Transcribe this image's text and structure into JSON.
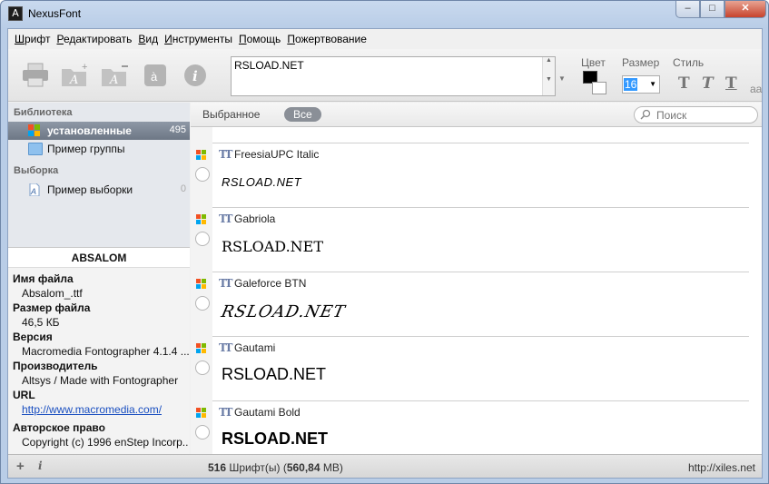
{
  "window": {
    "title": "NexusFont",
    "minimize": "–",
    "maximize": "□",
    "close": "✕"
  },
  "menu": [
    {
      "label": "Шрифт",
      "accel": "Ш",
      "rest": "рифт"
    },
    {
      "label": "Редактировать",
      "accel": "Р",
      "rest": "едактировать"
    },
    {
      "label": "Вид",
      "accel": "В",
      "rest": "ид"
    },
    {
      "label": "Инструменты",
      "accel": "И",
      "rest": "нструменты"
    },
    {
      "label": "Помощь",
      "accel": "П",
      "rest": "омощь"
    },
    {
      "label": "Пожертвование",
      "accel": "П",
      "rest": "ожертвование"
    }
  ],
  "toolbar": {
    "preview_text": "RSLOAD.NET",
    "color_label": "Цвет",
    "size_label": "Размер",
    "size_value": "16",
    "style_label": "Стиль",
    "style_t": "T",
    "aa": "aa",
    "icons": [
      "print-icon",
      "add-font-icon",
      "remove-font-icon",
      "character-map-icon",
      "info-icon"
    ],
    "colors": {
      "fore": "#000000",
      "back": "#ffffff"
    }
  },
  "library": {
    "header": "Библиотека",
    "items": [
      {
        "label": "установленные",
        "count": "495",
        "selected": true
      },
      {
        "label": "Пример группы",
        "count": ""
      }
    ],
    "selection_header": "Выборка",
    "selection_items": [
      {
        "label": "Пример выборки",
        "count": "0"
      }
    ]
  },
  "details": {
    "font_name": "ABSALOM",
    "fields": [
      {
        "label": "Имя файла",
        "value": "Absalom_.ttf"
      },
      {
        "label": "Размер файла",
        "value": "46,5 КБ"
      },
      {
        "label": "Версия",
        "value": "Macromedia Fontographer 4.1.4 ..."
      },
      {
        "label": "Производитель",
        "value": "Altsys / Made with Fontographer"
      },
      {
        "label": "URL",
        "value": "http://www.macromedia.com/"
      },
      {
        "label": "Авторское право",
        "value": "Copyright (c) 1996 enStep Incorp..."
      }
    ]
  },
  "filter": {
    "favorites": "Выбранное",
    "all": "Все",
    "search_placeholder": "Поиск"
  },
  "fonts": [
    {
      "name": "FreesiaUPC Italic",
      "preview": "RSLOAD.NET"
    },
    {
      "name": "Gabriola",
      "preview": "RSLOAD.NET"
    },
    {
      "name": "Galeforce BTN",
      "preview": "RSLOAD.NET"
    },
    {
      "name": "Gautami",
      "preview": "RSLOAD.NET"
    },
    {
      "name": "Gautami Bold",
      "preview": "RSLOAD.NET"
    }
  ],
  "status": {
    "count": "516",
    "count_label": "Шрифт(ы)",
    "size": "560,84",
    "size_unit": "MB",
    "url": "http://xiles.net"
  }
}
